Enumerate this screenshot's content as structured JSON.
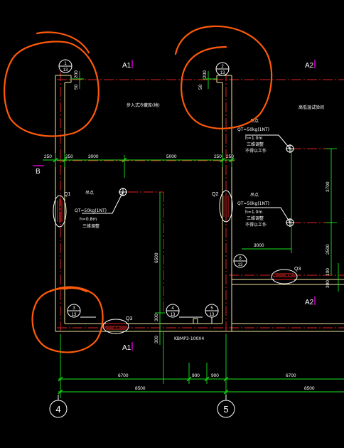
{
  "colors": {
    "background": "#000000",
    "wall": "#f0e6a0",
    "dimension": "#19e61e",
    "axis_red": "#e02020",
    "markup_orange": "#ff5a0a",
    "text_white": "#ffffff",
    "magenta": "#ff00ff"
  },
  "axis_labels": {
    "A1_top": "A1",
    "A2_top": "A2",
    "A2_mid": "A2",
    "A1_bottom": "A1",
    "B_left": "B"
  },
  "grid_axes": {
    "axis_4": "4",
    "axis_5": "5"
  },
  "detail_callouts": [
    {
      "num": "1",
      "sheet": "13"
    },
    {
      "num": "2",
      "sheet": "13"
    },
    {
      "num": "3",
      "sheet": "13"
    },
    {
      "num": "4",
      "sheet": "13"
    },
    {
      "num": "5",
      "sheet": "13"
    },
    {
      "num": "6",
      "sheet": "13"
    }
  ],
  "markers": {
    "Q1": "Q1",
    "Q2": "Q2",
    "Q3_left": "Q3",
    "Q3_right": "Q3"
  },
  "room_labels": {
    "room_left": "步入式冷藏库(地)",
    "room_right": "高低温试验间"
  },
  "annotations": {
    "hoist_label": "吊点",
    "load_1": "QT=50kg(1NT)",
    "height_1": "h=1.0m",
    "sub_1a": "三维调整",
    "sub_1b": "不得以工作",
    "load_2": "QT=50kg(1NT)",
    "height_2": "h=0.8m",
    "sub_2": "三维调整",
    "load_3": "QT=50kg(1NT)",
    "height_3": "h=1.0m",
    "sub_3a": "三维调整",
    "sub_3b": "不得以工作",
    "bottom_code": "KBMP3-100X4"
  },
  "dimensions": {
    "top_left_200": "200",
    "top_left_50": "50",
    "top_right_200": "200",
    "top_right_50": "50",
    "row_250_a": "250",
    "row_250_b": "250",
    "row_3000": "3000",
    "row_5000": "5000",
    "row_250_c": "250",
    "row_250_d": "250",
    "v_6500": "6500",
    "v_3700": "3700",
    "v_2500": "2500",
    "h_3000_right": "3000",
    "v_100_a": "100",
    "v_300_a": "300",
    "v_300_b": "300",
    "v_300_c": "300",
    "b_6700_left": "6700",
    "b_900_a": "900",
    "b_900_b": "900",
    "b_6700_right": "6700",
    "b_8500_left": "8500",
    "b_8500_right": "8500"
  }
}
